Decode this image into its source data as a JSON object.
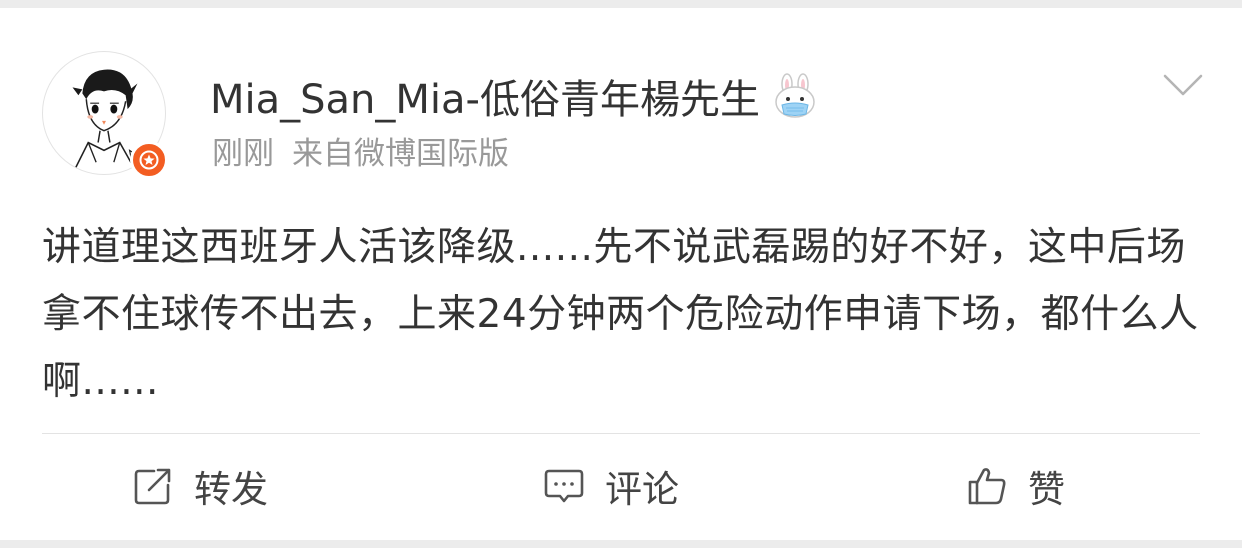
{
  "post": {
    "username": "Mia_San_Mia-低俗青年楊先生",
    "time": "刚刚",
    "source": "来自微博国际版",
    "text": "讲道理这西班牙人活该降级......先不说武磊踢的好不好，这中后场拿不住球传不出去，上来24分钟两个危险动作申请下场，都什么人啊......"
  },
  "actions": {
    "repost_label": "转发",
    "comment_label": "评论",
    "like_label": "赞"
  },
  "icons": {
    "menu": "chevron-down-icon",
    "badge": "vip-star-icon",
    "emoji": "bunny-mask-emoji-icon",
    "repost": "share-icon",
    "comment": "comment-icon",
    "like": "thumbs-up-icon"
  },
  "colors": {
    "badge": "#f35d22",
    "text": "#333333",
    "meta": "#999999"
  }
}
